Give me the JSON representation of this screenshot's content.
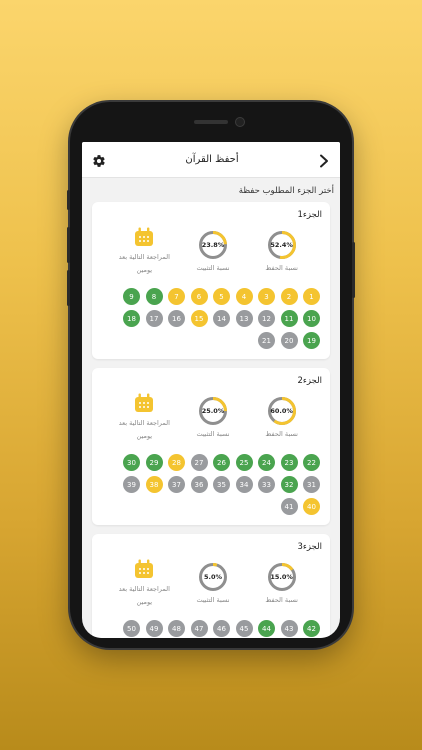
{
  "colors": {
    "green": "#4aa44f",
    "yellow": "#f4c430",
    "gray": "#999b9e",
    "ring_track": "#8f8f8f",
    "ring_fill": "#f4c430"
  },
  "app": {
    "title": "أحفظ القرآن",
    "back_icon": "chevron-right-icon",
    "settings_icon": "gear-icon",
    "subtitle": "أختر الجزء المطلوب حفظة"
  },
  "juz": [
    {
      "title": "الجزء1",
      "memorization_pct": "52.4%",
      "memorization_value": 0.524,
      "memorization_label": "نسبة الحفظ",
      "consolidation_pct": "23.8%",
      "consolidation_value": 0.238,
      "consolidation_label": "نسبة التثبيت",
      "review_label": "المراجعة التالية بعد يومين",
      "review_icon": "calendar-icon",
      "pages": [
        {
          "n": "1",
          "s": "y"
        },
        {
          "n": "2",
          "s": "y"
        },
        {
          "n": "3",
          "s": "y"
        },
        {
          "n": "4",
          "s": "y"
        },
        {
          "n": "5",
          "s": "y"
        },
        {
          "n": "6",
          "s": "y"
        },
        {
          "n": "7",
          "s": "y"
        },
        {
          "n": "8",
          "s": "g"
        },
        {
          "n": "9",
          "s": "g"
        },
        {
          "n": "10",
          "s": "g"
        },
        {
          "n": "11",
          "s": "g"
        },
        {
          "n": "12",
          "s": "x"
        },
        {
          "n": "13",
          "s": "x"
        },
        {
          "n": "14",
          "s": "x"
        },
        {
          "n": "15",
          "s": "y"
        },
        {
          "n": "16",
          "s": "x"
        },
        {
          "n": "17",
          "s": "x"
        },
        {
          "n": "18",
          "s": "g"
        },
        {
          "n": "19",
          "s": "g"
        },
        {
          "n": "20",
          "s": "x"
        },
        {
          "n": "21",
          "s": "x"
        }
      ]
    },
    {
      "title": "الجزء2",
      "memorization_pct": "60.0%",
      "memorization_value": 0.6,
      "memorization_label": "نسبة الحفظ",
      "consolidation_pct": "25.0%",
      "consolidation_value": 0.25,
      "consolidation_label": "نسبة التثبيت",
      "review_label": "المراجعة التالية بعد يومين",
      "review_icon": "calendar-icon",
      "pages": [
        {
          "n": "22",
          "s": "g"
        },
        {
          "n": "23",
          "s": "g"
        },
        {
          "n": "24",
          "s": "g"
        },
        {
          "n": "25",
          "s": "g"
        },
        {
          "n": "26",
          "s": "g"
        },
        {
          "n": "27",
          "s": "x"
        },
        {
          "n": "28",
          "s": "y"
        },
        {
          "n": "29",
          "s": "g"
        },
        {
          "n": "30",
          "s": "g"
        },
        {
          "n": "31",
          "s": "x"
        },
        {
          "n": "32",
          "s": "g"
        },
        {
          "n": "33",
          "s": "x"
        },
        {
          "n": "34",
          "s": "x"
        },
        {
          "n": "35",
          "s": "x"
        },
        {
          "n": "36",
          "s": "x"
        },
        {
          "n": "37",
          "s": "x"
        },
        {
          "n": "38",
          "s": "y"
        },
        {
          "n": "39",
          "s": "x"
        },
        {
          "n": "40",
          "s": "y"
        },
        {
          "n": "41",
          "s": "x"
        }
      ]
    },
    {
      "title": "الجزء3",
      "memorization_pct": "15.0%",
      "memorization_value": 0.15,
      "memorization_label": "نسبة الحفظ",
      "consolidation_pct": "5.0%",
      "consolidation_value": 0.05,
      "consolidation_label": "نسبة التثبيت",
      "review_label": "المراجعة التالية بعد يومين",
      "review_icon": "calendar-icon",
      "pages": [
        {
          "n": "42",
          "s": "g"
        },
        {
          "n": "43",
          "s": "x"
        },
        {
          "n": "44",
          "s": "g"
        },
        {
          "n": "45",
          "s": "x"
        },
        {
          "n": "46",
          "s": "x"
        },
        {
          "n": "47",
          "s": "x"
        },
        {
          "n": "48",
          "s": "x"
        },
        {
          "n": "49",
          "s": "x"
        },
        {
          "n": "50",
          "s": "x"
        },
        {
          "n": "51",
          "s": "x"
        }
      ]
    }
  ]
}
